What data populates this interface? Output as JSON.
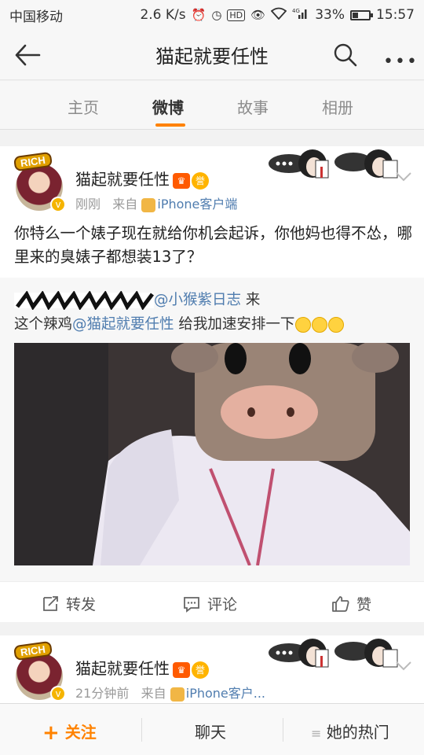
{
  "status_bar": {
    "carrier": "中国移动",
    "speed": "2.6 K/s",
    "network": "4G",
    "battery": "33%",
    "battery_level": 0.33,
    "time": "15:57"
  },
  "nav": {
    "title": "猫起就要任性"
  },
  "tabs": [
    {
      "label": "主页",
      "active": false
    },
    {
      "label": "微博",
      "active": true
    },
    {
      "label": "故事",
      "active": false
    },
    {
      "label": "相册",
      "active": false
    }
  ],
  "post1": {
    "username": "猫起就要任性",
    "time": "刚刚",
    "from_label": "来自",
    "source": "iPhone客户端",
    "text": "你特么一个婊子现在就给你机会起诉，你他妈也得不怂，哪里来的臭婊子都想装13了？",
    "badge": "RICH",
    "repost": {
      "mention_user": "@小猴紫日志",
      "suffix": "来",
      "line2_prefix": "这个辣鸡",
      "line2_mention": "@猫起就要任性",
      "line2_text": "给我加速安排一下"
    }
  },
  "actions": {
    "repost": "转发",
    "comment": "评论",
    "like": "赞"
  },
  "post2": {
    "username": "猫起就要任性",
    "time": "21分钟前",
    "from_label": "来自",
    "source": "iPhone客户...",
    "badge": "RICH"
  },
  "bottom_bar": {
    "follow": "关注",
    "chat": "聊天",
    "hot": "她的热门"
  },
  "colors": {
    "accent": "#ff8200",
    "link": "#507daf"
  }
}
